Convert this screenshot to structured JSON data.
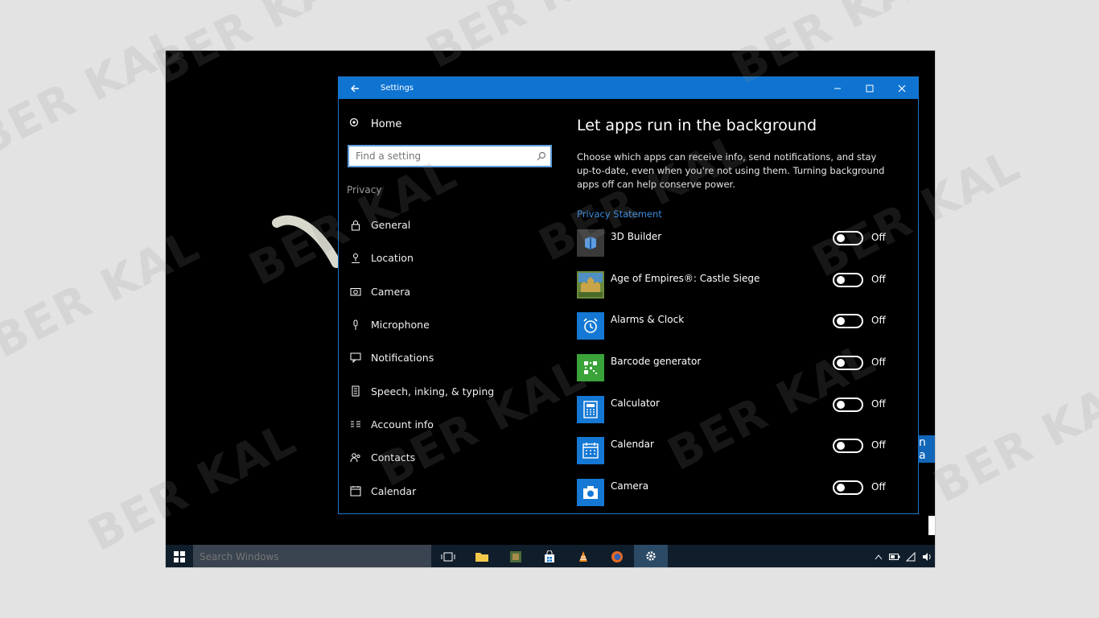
{
  "window": {
    "title": "Settings"
  },
  "sidebar": {
    "home_label": "Home",
    "search_placeholder": "Find a setting",
    "section_label": "Privacy",
    "items": [
      {
        "label": "General",
        "icon": "lock-icon"
      },
      {
        "label": "Location",
        "icon": "location-icon"
      },
      {
        "label": "Camera",
        "icon": "camera-icon"
      },
      {
        "label": "Microphone",
        "icon": "microphone-icon"
      },
      {
        "label": "Notifications",
        "icon": "notifications-icon"
      },
      {
        "label": "Speech, inking, & typing",
        "icon": "speech-icon"
      },
      {
        "label": "Account info",
        "icon": "account-info-icon"
      },
      {
        "label": "Contacts",
        "icon": "contacts-icon"
      },
      {
        "label": "Calendar",
        "icon": "calendar-icon"
      }
    ]
  },
  "content": {
    "title": "Let apps run in the background",
    "description": "Choose which apps can receive info, send notifications, and stay up-to-date, even when you're not using them. Turning background apps off can help conserve power.",
    "privacy_link": "Privacy Statement",
    "apps": [
      {
        "name": "3D Builder",
        "state": "Off",
        "icon": "3d-builder-icon",
        "color": "#3a3a3a"
      },
      {
        "name": "Age of Empires®: Castle Siege",
        "state": "Off",
        "icon": "age-of-empires-icon",
        "color": "#6b8a3a"
      },
      {
        "name": "Alarms & Clock",
        "state": "Off",
        "icon": "alarm-clock-icon",
        "color": "#1478d4"
      },
      {
        "name": "Barcode generator",
        "state": "Off",
        "icon": "barcode-icon",
        "color": "#3aa33a"
      },
      {
        "name": "Calculator",
        "state": "Off",
        "icon": "calculator-icon",
        "color": "#1478d4"
      },
      {
        "name": "Calendar",
        "state": "Off",
        "icon": "calendar-app-icon",
        "color": "#1478d4"
      },
      {
        "name": "Camera",
        "state": "Off",
        "icon": "camera-app-icon",
        "color": "#1478d4"
      }
    ]
  },
  "taskbar": {
    "search_placeholder": "Search Windows",
    "apps": [
      "task-view-icon",
      "file-explorer-icon",
      "app-icon",
      "store-icon",
      "vlc-icon",
      "firefox-icon",
      "settings-icon"
    ]
  },
  "edge_text": "n a",
  "watermark": "BER KAL",
  "colors": {
    "accent": "#0f74d1",
    "link": "#3a8de0",
    "taskbar": "#101d2b"
  }
}
